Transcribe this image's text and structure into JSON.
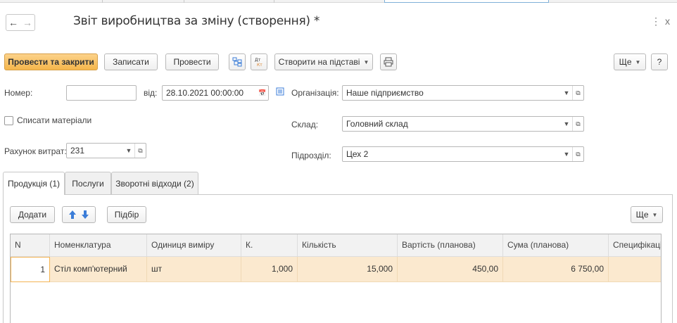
{
  "window": {
    "title": "Звіт виробництва за зміну (створення) *",
    "more_icon": "⋮",
    "close_icon": "x"
  },
  "nav": {
    "back_icon": "arrow-left",
    "forward_icon": "arrow-right"
  },
  "toolbar": {
    "post_and_close": "Провести та закрити",
    "save": "Записати",
    "post": "Провести",
    "structure_icon": "structure-icon",
    "dt_kt_icon": "dt-kt-icon",
    "create_based_on": "Створити на підставі",
    "print_icon": "printer-icon",
    "more": "Ще",
    "help": "?"
  },
  "form": {
    "number_label": "Номер:",
    "number_value": "",
    "date_label": "від:",
    "date_value": "28.10.2021 00:00:00",
    "organization_label": "Організація:",
    "organization_value": "Наше підприємство",
    "write_off_label": "Списати матеріали",
    "write_off_checked": false,
    "warehouse_label": "Склад:",
    "warehouse_value": "Головний склад",
    "cost_account_label": "Рахунок витрат:",
    "cost_account_value": "231",
    "department_label": "Підрозділ:",
    "department_value": "Цех 2"
  },
  "tabs": [
    {
      "label": "Продукція (1)",
      "active": true
    },
    {
      "label": "Послуги",
      "active": false
    },
    {
      "label": "Зворотні відходи (2)",
      "active": false
    }
  ],
  "table_toolbar": {
    "add": "Додати",
    "up_icon": "arrow-up-icon",
    "down_icon": "arrow-down-icon",
    "pick": "Підбір",
    "more": "Ще"
  },
  "table": {
    "columns": [
      "N",
      "Номенклатура",
      "Одиниця виміру",
      "К.",
      "Кількість",
      "Вартість (планова)",
      "Сума (планова)",
      "Специфікація"
    ],
    "rows": [
      [
        "1",
        "Стіл комп'ютерний",
        "шт",
        "1,000",
        "15,000",
        "450,00",
        "6 750,00",
        ""
      ]
    ]
  },
  "colors": {
    "primary_button": "#f5b64b",
    "selected_row": "#fbe9cf",
    "accent_blue": "#3b7dd8"
  }
}
